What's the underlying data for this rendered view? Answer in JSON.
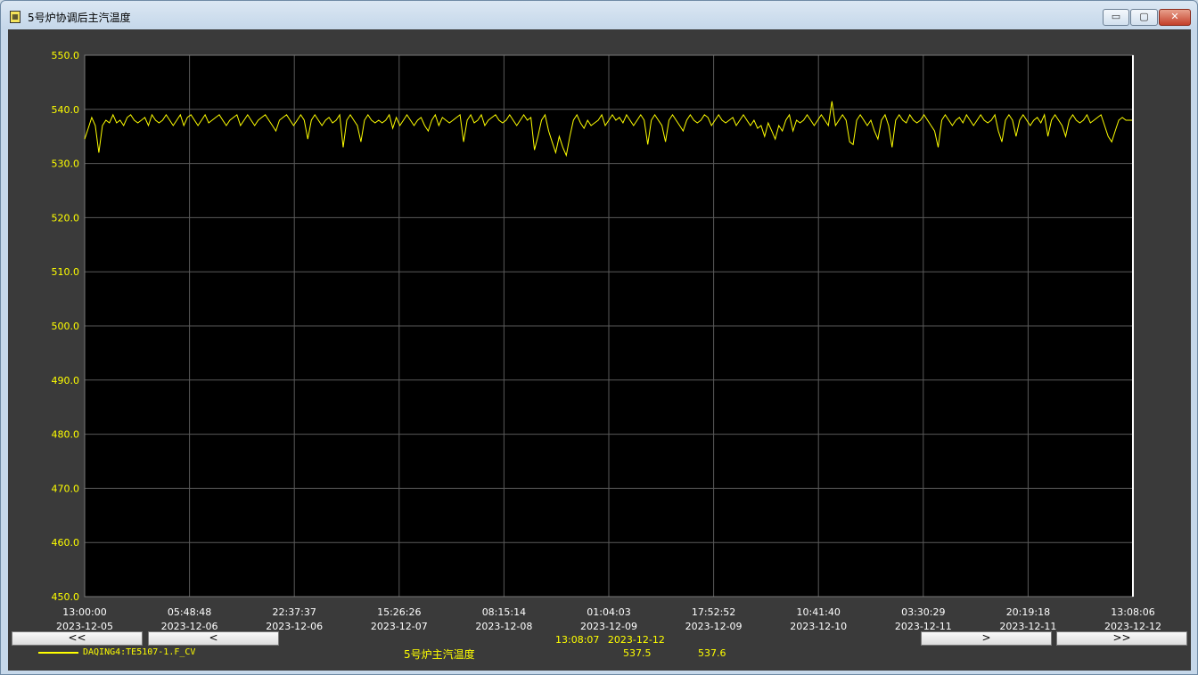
{
  "window": {
    "title": "5号炉协调后主汽温度",
    "buttons": {
      "minimize": "▭",
      "maximize": "▢",
      "close": "✕"
    }
  },
  "colors": {
    "series": "#ffff00",
    "background": "#000000",
    "grid": "#5a5a5a",
    "frame": "#3a3a3a"
  },
  "nav": {
    "first": "<<",
    "prev": "<",
    "next": ">",
    "last": ">>"
  },
  "cursor": {
    "time": "13:08:07",
    "date": "2023-12-12"
  },
  "legend": {
    "tag": "DAQING4:TE5107-1.F_CV",
    "description": "5号炉主汽温度",
    "value_1": "537.5",
    "value_2": "537.6"
  },
  "chart_data": {
    "type": "line",
    "title": "5号炉协调后主汽温度",
    "ylim": [
      450.0,
      550.0
    ],
    "y_ticks": [
      "550.0",
      "540.0",
      "530.0",
      "520.0",
      "510.0",
      "500.0",
      "490.0",
      "480.0",
      "470.0",
      "460.0",
      "450.0"
    ],
    "x_ticks": [
      {
        "time": "13:00:00",
        "date": "2023-12-05"
      },
      {
        "time": "05:48:48",
        "date": "2023-12-06"
      },
      {
        "time": "22:37:37",
        "date": "2023-12-06"
      },
      {
        "time": "15:26:26",
        "date": "2023-12-07"
      },
      {
        "time": "08:15:14",
        "date": "2023-12-08"
      },
      {
        "time": "01:04:03",
        "date": "2023-12-09"
      },
      {
        "time": "17:52:52",
        "date": "2023-12-09"
      },
      {
        "time": "10:41:40",
        "date": "2023-12-10"
      },
      {
        "time": "03:30:29",
        "date": "2023-12-11"
      },
      {
        "time": "20:19:18",
        "date": "2023-12-11"
      },
      {
        "time": "13:08:06",
        "date": "2023-12-12"
      }
    ],
    "grid": true,
    "series": [
      {
        "name": "DAQING4:TE5107-1.F_CV",
        "color": "#ffff00",
        "values": [
          534.5,
          536.5,
          538.5,
          537,
          532,
          537,
          538,
          537.5,
          539,
          537.5,
          538,
          537,
          538.5,
          539,
          538,
          537.5,
          538,
          538.5,
          537,
          539,
          538,
          537.5,
          538,
          539,
          538,
          537,
          538,
          539,
          537,
          538.5,
          539,
          538,
          537,
          538,
          539,
          537.5,
          538,
          538.5,
          539,
          538,
          537,
          538,
          538.5,
          539,
          537,
          538,
          539,
          538,
          537,
          538,
          538.5,
          539,
          538,
          537,
          536,
          538,
          538.5,
          539,
          538,
          537,
          538,
          539,
          538,
          534.5,
          538,
          539,
          538,
          537,
          538,
          538.5,
          537.5,
          538,
          539,
          533,
          538,
          539,
          538,
          537,
          534,
          538,
          539,
          538,
          537.5,
          538,
          537.5,
          538,
          539,
          536.5,
          538.5,
          537,
          538,
          539,
          538,
          537,
          538,
          538.5,
          537,
          536,
          538,
          539,
          537,
          538.5,
          538,
          537.5,
          538,
          538.5,
          539,
          534,
          538,
          539,
          537.5,
          538,
          539,
          537,
          538,
          538.5,
          539,
          538,
          537.5,
          538,
          539,
          538,
          537,
          538,
          539,
          538,
          538.5,
          532.5,
          535,
          538,
          539,
          536,
          534,
          532,
          535,
          533,
          531.5,
          535,
          538,
          539,
          537.5,
          536.5,
          538,
          537,
          537.5,
          538,
          539,
          537,
          538,
          539,
          538,
          538.5,
          537.5,
          539,
          538,
          537,
          538,
          539,
          538,
          533.5,
          538,
          539,
          538,
          537,
          534,
          538,
          539,
          538,
          537,
          536,
          538,
          539,
          538,
          537.5,
          538,
          539,
          538.5,
          537,
          538,
          539,
          538,
          537.5,
          538,
          538.5,
          537,
          538,
          539,
          538,
          537,
          538,
          536.5,
          537,
          535,
          537.5,
          536,
          534.5,
          537,
          536,
          538,
          539,
          536,
          538,
          537.5,
          538,
          539,
          538,
          537,
          538,
          539,
          538,
          537,
          541.5,
          537,
          538,
          539,
          538,
          534,
          533.5,
          538,
          539,
          538,
          537,
          538,
          536,
          534.5,
          538,
          539,
          537,
          533,
          538,
          539,
          538,
          537.5,
          539,
          538,
          537.5,
          538,
          539,
          538,
          537,
          536,
          533,
          538,
          539,
          538,
          537,
          538,
          538.5,
          537.5,
          539,
          538,
          537,
          538,
          539,
          538,
          537.5,
          538,
          539,
          536,
          534,
          538,
          539,
          538,
          535,
          538,
          539,
          538,
          537,
          538,
          538.5,
          537.5,
          539,
          535,
          538,
          539,
          538,
          537,
          535,
          538,
          539,
          538,
          537.5,
          538,
          539,
          537.5,
          538,
          538.5,
          539,
          537,
          535,
          534,
          536,
          538,
          538.5,
          538,
          538,
          538
        ]
      }
    ]
  }
}
